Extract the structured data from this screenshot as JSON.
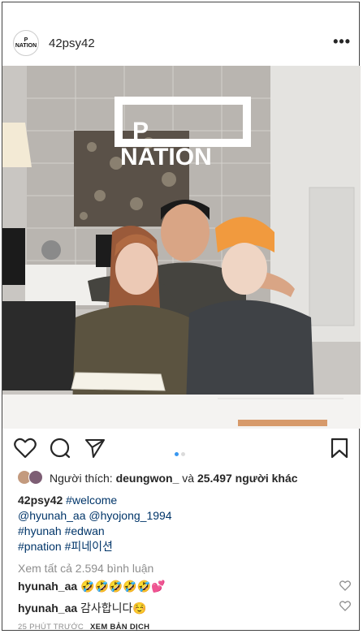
{
  "post": {
    "username": "42psy42",
    "avatar_logo_line1": "P",
    "avatar_logo_line2": "NATION",
    "more_icon": "more-horizontal-icon",
    "photo": {
      "sign_line1": "P",
      "sign_line2": "NATION"
    },
    "carousel": {
      "count": 2,
      "active": 0,
      "active_color": "#3897f0",
      "inactive_color": "#dbdbdb"
    },
    "likes": {
      "prefix": "Người thích: ",
      "user": "deungwon_",
      "middle": " và ",
      "count": "25.497 người khác"
    },
    "caption": {
      "author": "42psy42",
      "lines": [
        [
          "#welcome"
        ],
        [
          "@hyunah_aa",
          "@hyojong_1994"
        ],
        [
          "#hyunah",
          "#edwan"
        ],
        [
          "#pnation",
          "#피네이션"
        ]
      ]
    },
    "view_all": "Xem tất cả 2.594 bình luận",
    "comments": [
      {
        "user": "hyunah_aa",
        "text": "🤣🤣🤣🤣🤣💕"
      },
      {
        "user": "hyunah_aa",
        "text": "감사합니다☺️"
      }
    ],
    "timestamp": "25 PHÚT TRƯỚC",
    "translate": "XEM BẢN DỊCH"
  },
  "colors": {
    "link": "#003569",
    "muted": "#8e8e8e",
    "text": "#262626"
  }
}
